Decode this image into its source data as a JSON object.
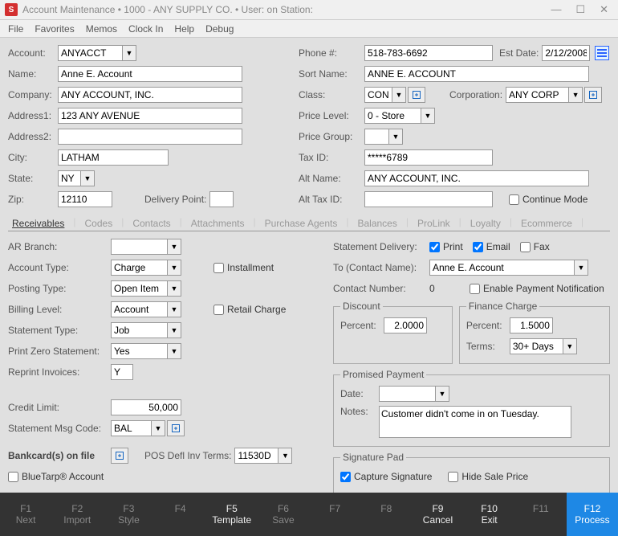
{
  "window": {
    "title": "Account Maintenance   •   1000 - ANY SUPPLY CO.   •   User:               on Station:"
  },
  "menu": {
    "file": "File",
    "favorites": "Favorites",
    "memos": "Memos",
    "clockin": "Clock In",
    "help": "Help",
    "debug": "Debug"
  },
  "labels": {
    "account": "Account:",
    "name": "Name:",
    "company": "Company:",
    "address1": "Address1:",
    "address2": "Address2:",
    "city": "City:",
    "state": "State:",
    "zip": "Zip:",
    "deliverypoint": "Delivery Point:",
    "phone": "Phone #:",
    "estdate": "Est Date:",
    "sortname": "Sort Name:",
    "class": "Class:",
    "corporation": "Corporation:",
    "pricelevel": "Price Level:",
    "pricegroup": "Price Group:",
    "taxid": "Tax ID:",
    "altname": "Alt  Name:",
    "alttaxid": "Alt Tax ID:",
    "continuemode": "Continue Mode"
  },
  "values": {
    "account": "ANYACCT",
    "name": "Anne E. Account",
    "company": "ANY ACCOUNT, INC.",
    "address1": "123 ANY AVENUE",
    "address2": "",
    "city": "LATHAM",
    "state": "NY",
    "zip": "12110",
    "deliverypoint": "",
    "phone": "518-783-6692",
    "estdate": "2/12/2008",
    "sortname": "ANNE E. ACCOUNT",
    "class": "CON",
    "corporation": "ANY CORP",
    "pricelevel": "0 - Store",
    "pricegroup": "",
    "taxid": "*****6789",
    "altname": "ANY ACCOUNT, INC.",
    "alttaxid": ""
  },
  "tabs": {
    "receivables": "Receivables",
    "codes": "Codes",
    "contacts": "Contacts",
    "attachments": "Attachments",
    "purchaseagents": "Purchase Agents",
    "balances": "Balances",
    "prolink": "ProLink",
    "loyalty": "Loyalty",
    "ecommerce": "Ecommerce"
  },
  "rec": {
    "labels": {
      "arbranch": "AR Branch:",
      "accounttype": "Account Type:",
      "postingtype": "Posting Type:",
      "billinglevel": "Billing Level:",
      "statementtype": "Statement Type:",
      "printzero": "Print Zero Statement:",
      "reprint": "Reprint Invoices:",
      "creditlimit": "Credit Limit:",
      "stmtmsgcode": "Statement Msg Code:",
      "bankcards": "Bankcard(s) on file",
      "posdefl": "POS Defl Inv Terms:",
      "bluetarp": "BlueTarp® Account",
      "installment": "Installment",
      "retailcharge": "Retail Charge",
      "stmtdelivery": "Statement Delivery:",
      "print": "Print",
      "email": "Email",
      "fax": "Fax",
      "tocontact": "To (Contact Name):",
      "contactnumber": "Contact Number:",
      "enablepaynotif": "Enable Payment Notification",
      "discount": "Discount",
      "financecharge": "Finance Charge",
      "percent": "Percent:",
      "terms": "Terms:",
      "promisedpayment": "Promised Payment",
      "date": "Date:",
      "notes": "Notes:",
      "signaturepad": "Signature Pad",
      "capturesig": "Capture Signature",
      "hidesale": "Hide Sale Price"
    },
    "values": {
      "arbranch": "",
      "accounttype": "Charge",
      "postingtype": "Open Item",
      "billinglevel": "Account",
      "statementtype": "Job",
      "printzero": "Yes",
      "reprint": "Y",
      "creditlimit": "50,000",
      "stmtmsgcode": "BAL",
      "posdefl": "11530D",
      "tocontact": "Anne E. Account",
      "contactnumber": "0",
      "discountpercent": "2.0000",
      "financepercent": "1.5000",
      "financeterms": "30+ Days",
      "promiseddate": "",
      "promisednotes": "Customer didn't come in on Tuesday."
    }
  },
  "footer": {
    "f1": "F1",
    "f1l": "Next",
    "f2": "F2",
    "f2l": "Import",
    "f3": "F3",
    "f3l": "Style",
    "f4": "F4",
    "f5": "F5",
    "f5l": "Template",
    "f6": "F6",
    "f6l": "Save",
    "f7": "F7",
    "f8": "F8",
    "f9": "F9",
    "f9l": "Cancel",
    "f10": "F10",
    "f10l": "Exit",
    "f11": "F11",
    "f12": "F12",
    "f12l": "Process"
  }
}
